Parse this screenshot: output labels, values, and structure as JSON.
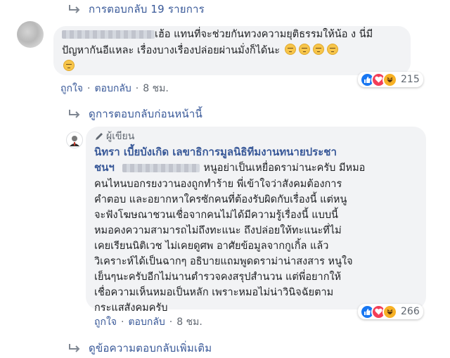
{
  "thread": {
    "replies_link": "การตอบกลับ 19 รายการ",
    "prev_replies_link": "ดูการตอบกลับก่อนหน้านี้",
    "more_replies_link": "ดูข้อความตอบกลับเพิ่มเติม"
  },
  "comment1": {
    "text_line1": "เฮ้อ แทนที่จะช่วยกันทวงความยุติธรรมให้น้อ ง นี่มี",
    "text_line2": "ปัญหากันอีแหละ เรื่องบางเรื่องปล่อยผ่านมั่งก็ได้นะ",
    "like_label": "ถูกใจ",
    "reply_label": "ตอบกลับ",
    "time": "8 ชม.",
    "reaction_count": "215"
  },
  "comment2": {
    "author_badge": "ผู้เขียน",
    "page_name_line1": "นิทรา เบี้ยบังเกิด เลขาธิการมูลนิธิทีมงานทนายประชา",
    "page_name_line2": "ชนฯ",
    "lines": [
      "หนูอย่าเป็นเหยื่อดราม่านะครับ มีหมอ",
      "คนไหนบอกรยงวานองถูกทำร้าย พี่เข้าใจว่าสังคมต้องการ",
      "คำตอบ และอยากหาใครซักคนที่ต้องรับผิดกับเรื่องนี้ แต่หนู",
      "จะฟังโฆษณาชวนเชื่อจากคนไม่ได้มีความรู้เรื่องนี้ แบบนี้",
      "หมอคงความสามารถไม่ถึงทะแนะ ถึงปล่อยให้ทะแนะที่ไม่",
      "เคยเรียนนิติเวช ไม่เคยดูศพ อาศัยข้อมูลจากกูเกิ้ล แล้ว",
      "วิเคราะห์ได้เป็นฉากๆ อธิบายแถมพูดดราม่าน่าสงสาร หนูใจ",
      "เย็นๆนะครับอีกไม่นานตำรวจคงสรุปสำนวน แต่พี่อยากให้",
      "เชื่อความเห็นหมอเป็นหลัก เพราะหมอไม่น่าวินิจฉัยตาม",
      "กระแสสังคมครับ"
    ],
    "like_label": "ถูกใจ",
    "reply_label": "ตอบกลับ",
    "time": "8 ชม.",
    "reaction_count": "266"
  },
  "colors": {
    "link": "#385898",
    "bubble": "#f2f3f5",
    "meta": "#606770",
    "like": "#1877f2",
    "love": "#f33e58",
    "haha": "#f7b125"
  },
  "icons": [
    "reply-arrow-icon",
    "pencil-icon",
    "like-reaction-icon",
    "love-reaction-icon",
    "haha-reaction-icon",
    "emoji-icon"
  ]
}
